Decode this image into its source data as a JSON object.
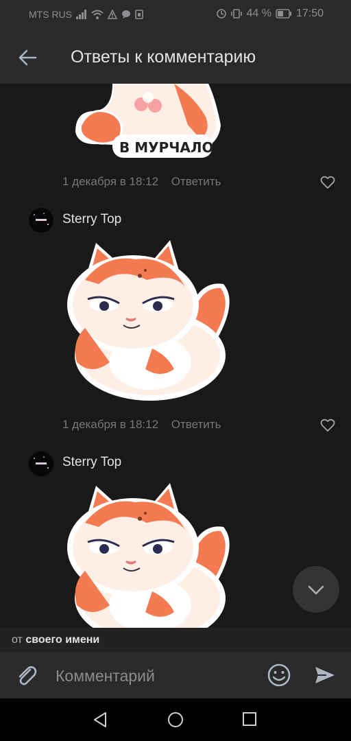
{
  "status_bar": {
    "carrier": "MTS RUS",
    "battery_percent": "44 %",
    "time": "17:50"
  },
  "header": {
    "title": "Ответы к комментарию",
    "back_icon": "arrow-left-icon"
  },
  "comments": [
    {
      "author": "",
      "sticker_caption": "В МУРЧАЛО",
      "date": "1 декабря в 18:12",
      "reply_label": "Ответить"
    },
    {
      "author": "Sterry Top",
      "date": "1 декабря в 18:12",
      "reply_label": "Ответить"
    },
    {
      "author": "Sterry Top"
    }
  ],
  "sender": {
    "prefix": "от",
    "name": "своего имени"
  },
  "input": {
    "placeholder": "Комментарий"
  },
  "colors": {
    "background": "#19191a",
    "bar": "#2a2a2b",
    "sticker_orange": "#f47a52",
    "sticker_cream": "#fdeee6"
  }
}
